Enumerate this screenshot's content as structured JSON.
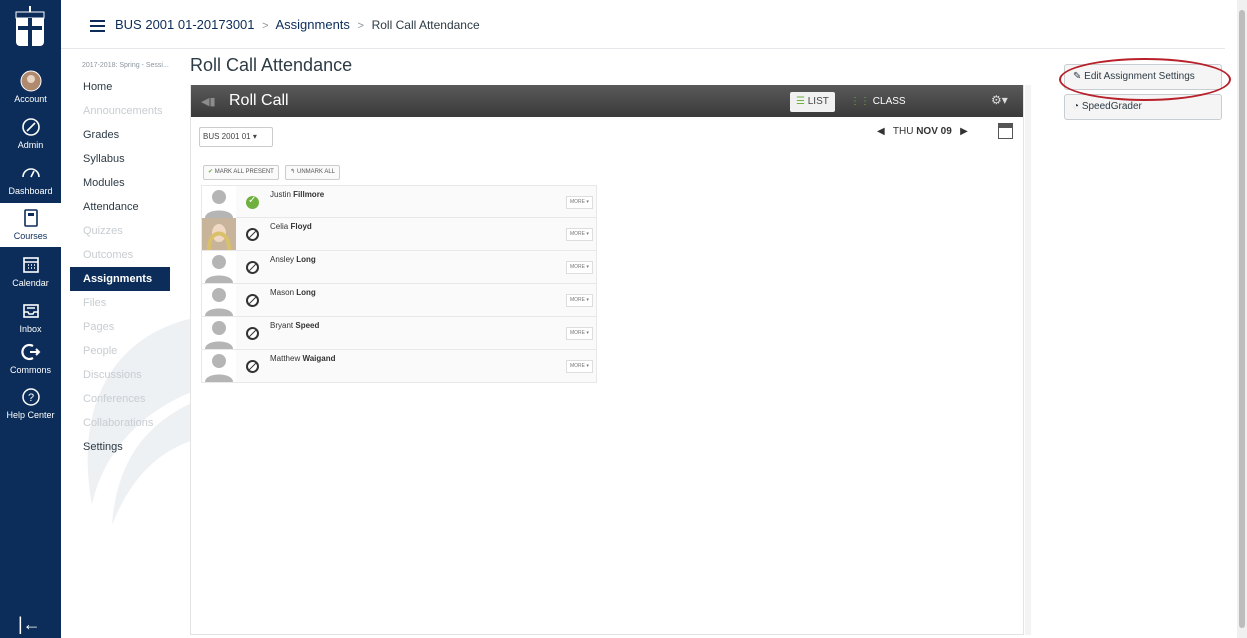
{
  "global_nav": {
    "items": [
      {
        "label": "Account",
        "icon": "avatar-icon"
      },
      {
        "label": "Admin",
        "icon": "admin-shield-icon"
      },
      {
        "label": "Dashboard",
        "icon": "dashboard-icon"
      },
      {
        "label": "Courses",
        "icon": "book-icon",
        "active": true
      },
      {
        "label": "Calendar",
        "icon": "calendar-icon"
      },
      {
        "label": "Inbox",
        "icon": "inbox-icon"
      },
      {
        "label": "Commons",
        "icon": "commons-icon"
      },
      {
        "label": "Help Center",
        "icon": "help-icon"
      }
    ],
    "collapse_glyph": "|←"
  },
  "breadcrumb": {
    "course": "BUS 2001 01-20173001",
    "section": "Assignments",
    "current": "Roll Call Attendance",
    "separator": ">"
  },
  "course_nav": {
    "term": "2017-2018: Spring - Sessi...",
    "items": [
      {
        "label": "Home",
        "state": "normal"
      },
      {
        "label": "Announcements",
        "state": "disabled"
      },
      {
        "label": "Grades",
        "state": "normal"
      },
      {
        "label": "Syllabus",
        "state": "normal"
      },
      {
        "label": "Modules",
        "state": "normal"
      },
      {
        "label": "Attendance",
        "state": "normal"
      },
      {
        "label": "Quizzes",
        "state": "disabled"
      },
      {
        "label": "Outcomes",
        "state": "disabled"
      },
      {
        "label": "Assignments",
        "state": "active"
      },
      {
        "label": "Files",
        "state": "disabled"
      },
      {
        "label": "Pages",
        "state": "disabled"
      },
      {
        "label": "People",
        "state": "disabled"
      },
      {
        "label": "Discussions",
        "state": "disabled"
      },
      {
        "label": "Conferences",
        "state": "disabled"
      },
      {
        "label": "Collaborations",
        "state": "disabled"
      },
      {
        "label": "Settings",
        "state": "normal"
      }
    ]
  },
  "page_title": "Roll Call Attendance",
  "roll_call": {
    "title": "Roll Call",
    "view_list": "LIST",
    "view_class": "CLASS",
    "section_select": "BUS 2001 01 ▾",
    "date_prefix": "THU",
    "date_bold": "NOV 09",
    "mark_all": "MARK ALL PRESENT",
    "unmark_all": "UNMARK ALL",
    "more_label": "MORE ▾",
    "students": [
      {
        "first": "Justin",
        "last": "Fillmore",
        "status": "present",
        "photo": false
      },
      {
        "first": "Celia",
        "last": "Floyd",
        "status": "unmarked",
        "photo": true
      },
      {
        "first": "Ansley",
        "last": "Long",
        "status": "unmarked",
        "photo": false
      },
      {
        "first": "Mason",
        "last": "Long",
        "status": "unmarked",
        "photo": false
      },
      {
        "first": "Bryant",
        "last": "Speed",
        "status": "unmarked",
        "photo": false
      },
      {
        "first": "Matthew",
        "last": "Waigand",
        "status": "unmarked",
        "photo": false
      }
    ]
  },
  "sidebar_right": {
    "edit_settings": "Edit Assignment Settings",
    "speedgrader": "SpeedGrader"
  },
  "colors": {
    "nav_bg": "#0c2d59",
    "present_green": "#6fb03f",
    "highlight_red": "#b8202a"
  }
}
